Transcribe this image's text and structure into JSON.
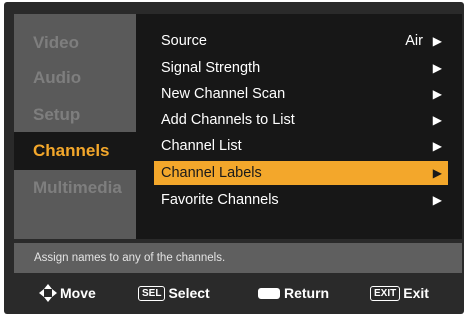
{
  "tabs": [
    {
      "label": "Video",
      "active": false
    },
    {
      "label": "Audio",
      "active": false
    },
    {
      "label": "Setup",
      "active": false
    },
    {
      "label": "Channels",
      "active": true
    },
    {
      "label": "Multimedia",
      "active": false
    }
  ],
  "menu": {
    "items": [
      {
        "label": "Source",
        "value": "Air",
        "arrow": "▶"
      },
      {
        "label": "Signal Strength",
        "value": "",
        "arrow": "▶"
      },
      {
        "label": "New Channel Scan",
        "value": "",
        "arrow": "▶"
      },
      {
        "label": "Add Channels to List",
        "value": "",
        "arrow": "▶"
      },
      {
        "label": "Channel List",
        "value": "",
        "arrow": "▶"
      },
      {
        "label": "Channel Labels",
        "value": "",
        "arrow": "▶",
        "selected": true
      },
      {
        "label": "Favorite Channels",
        "value": "",
        "arrow": "▶"
      }
    ]
  },
  "hint": "Assign names to any of the channels.",
  "footer": {
    "move_label": "Move",
    "select_key": "SEL",
    "select_label": "Select",
    "return_label": "Return",
    "exit_key": "EXIT",
    "exit_label": "Exit"
  },
  "colors": {
    "accent": "#f3a72b",
    "panel": "#171717",
    "tab_bg": "#5a5a5a",
    "frame": "#2a2a2a"
  }
}
